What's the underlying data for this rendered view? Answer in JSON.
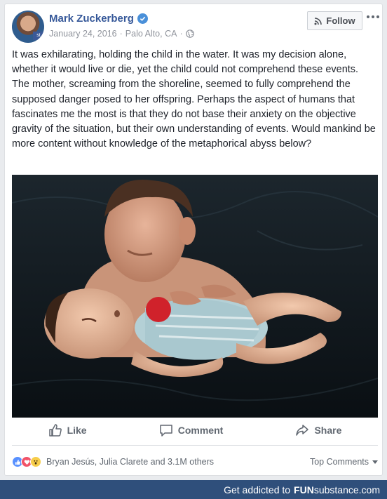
{
  "post": {
    "author": "Mark Zuckerberg",
    "date": "January 24, 2016",
    "location": "Palo Alto, CA",
    "follow_label": "Follow",
    "text": "It was exhilarating, holding the child in the water. It was my decision alone, whether it would live or die, yet the child could not comprehend these events. The mother, screaming from the shoreline, seemed to fully comprehend the supposed danger posed to her offspring. Perhaps the aspect of humans that fascinates me the most is that they do not base their anxiety on the objective gravity of the situation, but their own understanding of events. Would mankind be more content without knowledge of the metaphorical abyss below?"
  },
  "actions": {
    "like": "Like",
    "comment": "Comment",
    "share": "Share"
  },
  "reactions": {
    "names": "Bryan Jesús, Julia Clarete and 3.1M others",
    "top_comments": "Top Comments"
  },
  "banner": {
    "prefix": "Get addicted to",
    "brand_bold": "FUN",
    "brand_light": "substance",
    "brand_suffix": ".com"
  },
  "colors": {
    "link_blue": "#365899",
    "banner_bg": "#2f4f7b",
    "like_blue": "#5890ff",
    "love_red": "#f25268",
    "wow_yellow": "#f7cd4a"
  }
}
